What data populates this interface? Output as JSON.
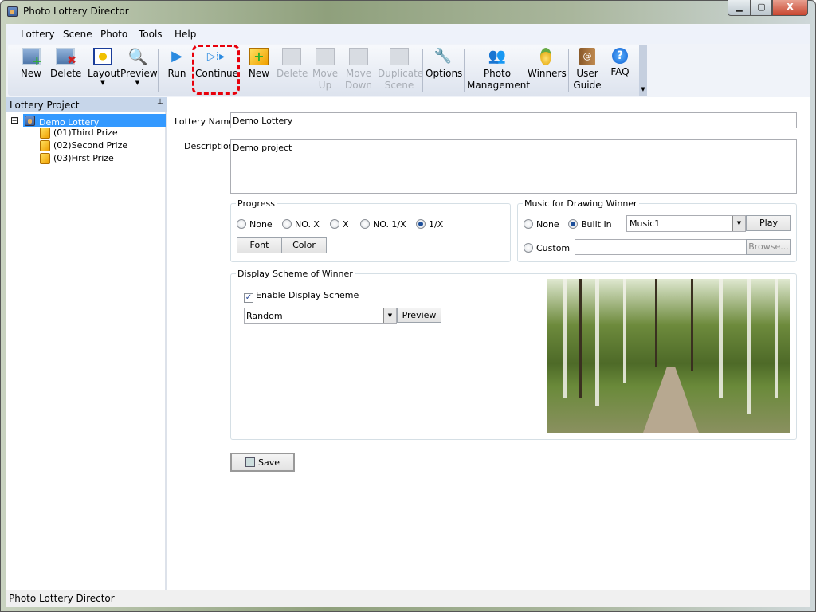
{
  "window": {
    "title": "Photo Lottery Director",
    "minimize": "▁",
    "maximize": "▢",
    "close": "X"
  },
  "menu": [
    "Lottery",
    "Scene",
    "Photo",
    "Tools",
    "Help"
  ],
  "toolbar": [
    {
      "label": "New",
      "icon": "add-user-icon",
      "enabled": true
    },
    {
      "label": "Delete",
      "icon": "delete-user-icon",
      "enabled": true
    },
    {
      "label": "Layout",
      "icon": "layout-icon",
      "enabled": true,
      "dropdown": true
    },
    {
      "label": "Preview",
      "icon": "magnifier-icon",
      "enabled": true,
      "dropdown": true
    },
    {
      "label": "Run",
      "icon": "play-icon",
      "enabled": true
    },
    {
      "label": "Continue",
      "icon": "continue-icon",
      "enabled": true,
      "highlighted": true
    },
    {
      "label": "New",
      "icon": "new-scene-cube-icon",
      "enabled": true
    },
    {
      "label": "Delete",
      "icon": "delete-scene-cube-icon",
      "enabled": false
    },
    {
      "label": "Move Up",
      "icon": "move-up-cube-icon",
      "enabled": false
    },
    {
      "label": "Move Down",
      "icon": "move-down-cube-icon",
      "enabled": false
    },
    {
      "label": "Duplicate Scene",
      "icon": "duplicate-cube-icon",
      "enabled": false
    },
    {
      "label": "Options",
      "icon": "wrench-icon",
      "enabled": true
    },
    {
      "label": "Photo Management",
      "icon": "people-icon",
      "enabled": true
    },
    {
      "label": "Winners",
      "icon": "medal-icon",
      "enabled": true
    },
    {
      "label": "User Guide",
      "icon": "book-icon",
      "enabled": true
    },
    {
      "label": "FAQ",
      "icon": "help-icon",
      "enabled": true
    }
  ],
  "left_panel": {
    "title": "Lottery Project",
    "pin": "📌",
    "tree": {
      "root": "Demo Lottery",
      "expander": "⊟",
      "children": [
        "(01)Third Prize",
        "(02)Second Prize",
        "(03)First Prize"
      ]
    }
  },
  "form": {
    "name_label": "Lottery Name",
    "name_value": "Demo Lottery",
    "desc_label": "Description",
    "desc_value": "Demo project",
    "progress": {
      "title": "Progress",
      "options": [
        "None",
        "NO. X",
        "X",
        "NO. 1/X",
        "1/X"
      ],
      "selected": "1/X",
      "font_btn": "Font",
      "color_btn": "Color"
    },
    "music": {
      "title": "Music for Drawing Winner",
      "none": "None",
      "builtin": "Built In",
      "selected": "Built In",
      "track": "Music1",
      "play": "Play",
      "custom": "Custom",
      "custom_value": "",
      "browse": "Browse..."
    },
    "scheme": {
      "title": "Display Scheme of Winner",
      "enable_label": "Enable Display Scheme",
      "enabled": true,
      "value": "Random",
      "preview": "Preview"
    },
    "save": "Save"
  },
  "status": "Photo Lottery Director",
  "colors": {
    "accent": "#3399ff",
    "highlight": "#e8000b"
  }
}
